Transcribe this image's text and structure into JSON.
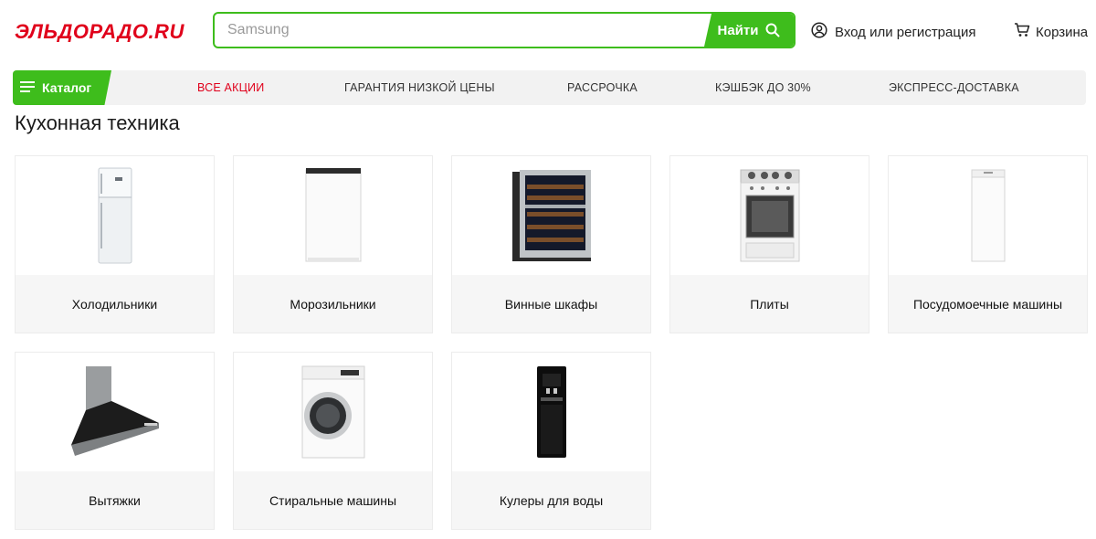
{
  "header": {
    "logo_text": "ЭЛЬДОРАДО.RU",
    "search": {
      "placeholder": "Samsung",
      "value": "",
      "button_label": "Найти"
    },
    "login_label": "Вход или регистрация",
    "cart_label": "Корзина"
  },
  "nav": {
    "catalog_label": "Каталог",
    "items": [
      {
        "label": "ВСЕ АКЦИИ"
      },
      {
        "label": "ГАРАНТИЯ НИЗКОЙ ЦЕНЫ"
      },
      {
        "label": "РАССРОЧКА"
      },
      {
        "label": "КЭШБЭК ДО 30%"
      },
      {
        "label": "ЭКСПРЕСС-ДОСТАВКА"
      }
    ]
  },
  "page_title": "Кухонная техника",
  "categories": [
    {
      "label": "Холодильники",
      "icon": "fridge-icon"
    },
    {
      "label": "Морозильники",
      "icon": "freezer-icon"
    },
    {
      "label": "Винные шкафы",
      "icon": "wine-cabinet-icon"
    },
    {
      "label": "Плиты",
      "icon": "stove-icon"
    },
    {
      "label": "Посудомоечные машины",
      "icon": "dishwasher-icon"
    },
    {
      "label": "Вытяжки",
      "icon": "range-hood-icon"
    },
    {
      "label": "Стиральные машины",
      "icon": "washing-machine-icon"
    },
    {
      "label": "Кулеры для воды",
      "icon": "water-cooler-icon"
    }
  ],
  "colors": {
    "brand_green": "#3ebd1c",
    "brand_red": "#e0001b",
    "nav_bg": "#f2f2f2",
    "card_label_bg": "#f6f6f6"
  }
}
